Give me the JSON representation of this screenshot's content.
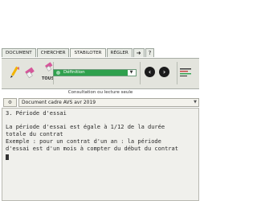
{
  "tabs": [
    {
      "label": "DOCUMENT"
    },
    {
      "label": "CHERCHER"
    },
    {
      "label": "STABILOTER"
    },
    {
      "label": "RÉGLER"
    },
    {
      "label": "➜"
    },
    {
      "label": "?"
    }
  ],
  "toolbar": {
    "tous_label": "TOUS",
    "stabilo_select_value": "Définition"
  },
  "consultation_label": "Consultation ou lecture seule",
  "document": {
    "icon": "book-gear-icon",
    "selected": "Document cadre AVS avr 2019"
  },
  "content": {
    "heading": "3. Période d'essai",
    "line1": "La période d'essai est égale à 1/12 de la durée",
    "line2": "totale du contrat",
    "line3": "Exemple : pour un contrat d'un an : la période",
    "line4": "d'essai est d'un mois à compter du début du contrat"
  }
}
